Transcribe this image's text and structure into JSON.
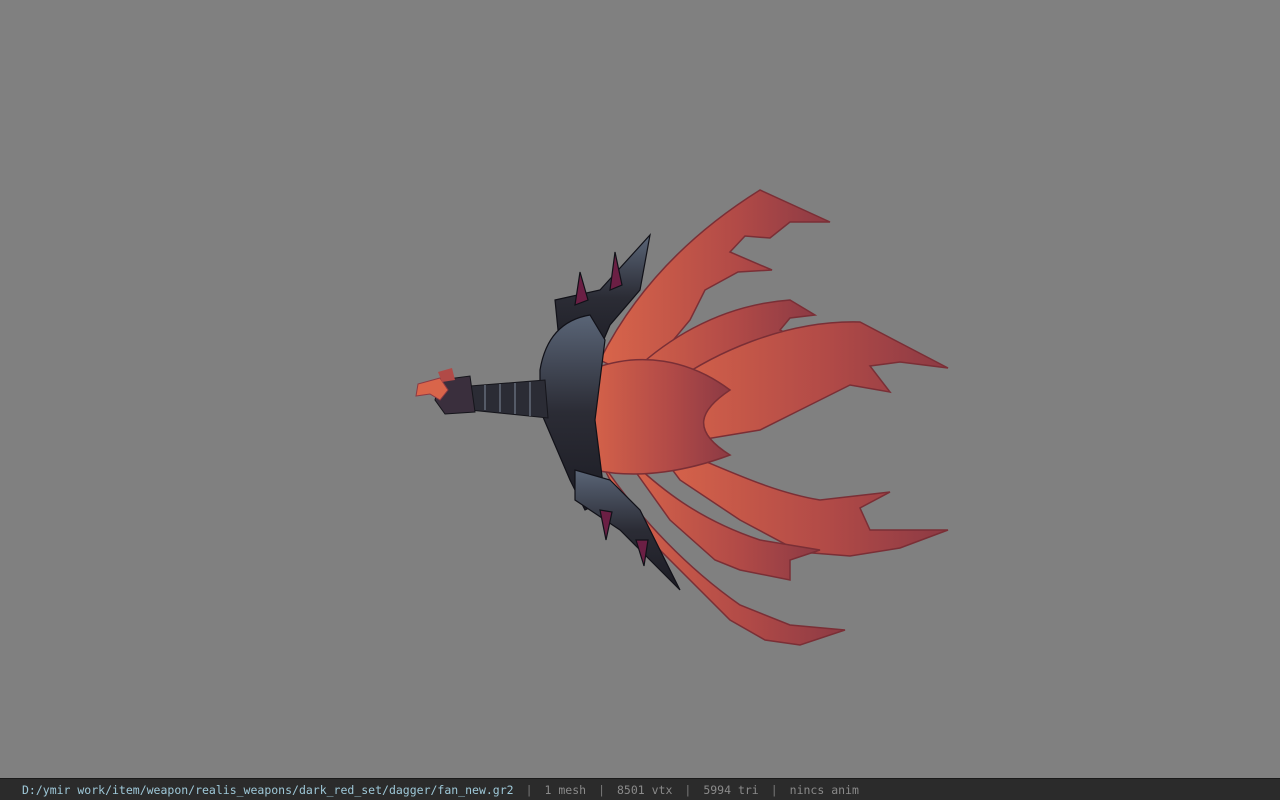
{
  "viewport": {
    "background": "#808080",
    "model": {
      "icon": "fan-weapon-model",
      "colors": {
        "blade": "#b14a47",
        "blade_dark": "#7a2f36",
        "blade_highlight": "#d9654a",
        "hilt": "#2b2c35",
        "hilt_highlight": "#5a6577",
        "accent": "#6b1f44"
      }
    }
  },
  "statusbar": {
    "file_path": "D:/ymir work/item/weapon/realis_weapons/dark_red_set/dagger/fan_new.gr2",
    "separator": "|",
    "mesh_count": "1 mesh",
    "vertex_count": "8501 vtx",
    "triangle_count": "5994 tri",
    "anim_status": "nincs anim"
  }
}
